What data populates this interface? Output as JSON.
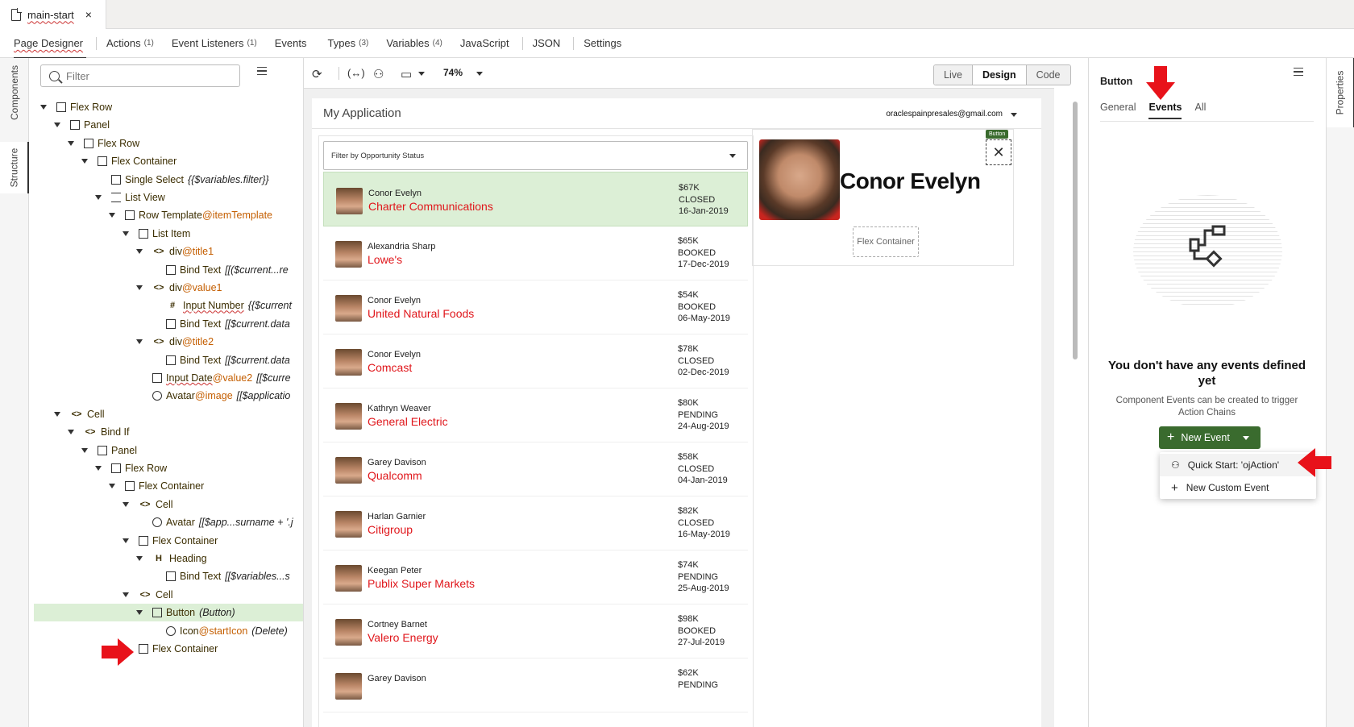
{
  "tab": {
    "title": "main-start",
    "close": "×"
  },
  "designer_tabs": [
    {
      "label": "Page Designer",
      "count": ""
    },
    {
      "label": "Actions",
      "count": "(1)"
    },
    {
      "label": "Event Listeners",
      "count": "(1)"
    },
    {
      "label": "Events",
      "count": ""
    },
    {
      "label": "Types",
      "count": "(3)"
    },
    {
      "label": "Variables",
      "count": "(4)"
    },
    {
      "label": "JavaScript",
      "count": ""
    },
    {
      "label": "JSON",
      "count": ""
    },
    {
      "label": "Settings",
      "count": ""
    }
  ],
  "left_strip": {
    "components": "Components",
    "structure": "Structure"
  },
  "structure": {
    "filter_placeholder": "Filter",
    "nodes": [
      {
        "label": "Flex Row",
        "at": "",
        "expr": ""
      },
      {
        "label": "Panel",
        "at": "",
        "expr": ""
      },
      {
        "label": "Flex Row",
        "at": "",
        "expr": ""
      },
      {
        "label": "Flex Container",
        "at": "",
        "expr": ""
      },
      {
        "label": "Single Select",
        "at": "",
        "expr": "{{$variables.filter}}"
      },
      {
        "label": "List View",
        "at": "",
        "expr": ""
      },
      {
        "label": "Row Template",
        "at": "@itemTemplate",
        "expr": ""
      },
      {
        "label": "List Item",
        "at": "",
        "expr": ""
      },
      {
        "label": "div",
        "at": "@title1",
        "expr": ""
      },
      {
        "label": "Bind Text",
        "at": "",
        "expr": "[[($current...re"
      },
      {
        "label": "div",
        "at": "@value1",
        "expr": ""
      },
      {
        "label": "Input Number",
        "at": "",
        "expr": "{{$current"
      },
      {
        "label": "Bind Text",
        "at": "",
        "expr": "[[$current.data"
      },
      {
        "label": "div",
        "at": "@title2",
        "expr": ""
      },
      {
        "label": "Bind Text",
        "at": "",
        "expr": "[[$current.data"
      },
      {
        "label": "Input Date",
        "at": "@value2",
        "expr": "[[$curre"
      },
      {
        "label": "Avatar",
        "at": "@image",
        "expr": "[[$applicatio"
      },
      {
        "label": "Cell",
        "at": "",
        "expr": ""
      },
      {
        "label": "Bind If",
        "at": "",
        "expr": ""
      },
      {
        "label": "Panel",
        "at": "",
        "expr": ""
      },
      {
        "label": "Flex Row",
        "at": "",
        "expr": ""
      },
      {
        "label": "Flex Container",
        "at": "",
        "expr": ""
      },
      {
        "label": "Cell",
        "at": "",
        "expr": ""
      },
      {
        "label": "Avatar",
        "at": "",
        "expr": "[[$app...surname + '.j"
      },
      {
        "label": "Flex Container",
        "at": "",
        "expr": ""
      },
      {
        "label": "Heading",
        "at": "",
        "expr": ""
      },
      {
        "label": "Bind Text",
        "at": "",
        "expr": "[[$variables...s"
      },
      {
        "label": "Cell",
        "at": "",
        "expr": ""
      },
      {
        "label": "Button",
        "at": "",
        "expr": "(Button)"
      },
      {
        "label": "Icon",
        "at": "@startIcon",
        "expr": "(Delete)"
      },
      {
        "label": "Flex Container",
        "at": "",
        "expr": ""
      }
    ]
  },
  "toolbar": {
    "zoom": "74%",
    "live": "Live",
    "design": "Design",
    "code": "Code"
  },
  "app": {
    "title": "My Application",
    "user": "oraclespainpresales@gmail.com",
    "filter_placeholder": "Filter by Opportunity Status",
    "rows": [
      {
        "name": "Conor Evelyn",
        "company": "Charter Communications",
        "amount": "$67K",
        "status": "CLOSED",
        "date": "16-Jan-2019"
      },
      {
        "name": "Alexandria Sharp",
        "company": "Lowe's",
        "amount": "$65K",
        "status": "BOOKED",
        "date": "17-Dec-2019"
      },
      {
        "name": "Conor Evelyn",
        "company": "United Natural Foods",
        "amount": "$54K",
        "status": "BOOKED",
        "date": "06-May-2019"
      },
      {
        "name": "Conor Evelyn",
        "company": "Comcast",
        "amount": "$78K",
        "status": "CLOSED",
        "date": "02-Dec-2019"
      },
      {
        "name": "Kathryn Weaver",
        "company": "General Electric",
        "amount": "$80K",
        "status": "PENDING",
        "date": "24-Aug-2019"
      },
      {
        "name": "Garey Davison",
        "company": "Qualcomm",
        "amount": "$58K",
        "status": "CLOSED",
        "date": "04-Jan-2019"
      },
      {
        "name": "Harlan Garnier",
        "company": "Citigroup",
        "amount": "$82K",
        "status": "CLOSED",
        "date": "16-May-2019"
      },
      {
        "name": "Keegan Peter",
        "company": "Publix Super Markets",
        "amount": "$74K",
        "status": "PENDING",
        "date": "25-Aug-2019"
      },
      {
        "name": "Cortney Barnet",
        "company": "Valero Energy",
        "amount": "$98K",
        "status": "BOOKED",
        "date": "27-Jul-2019"
      },
      {
        "name": "Garey Davison",
        "company": "",
        "amount": "$62K",
        "status": "PENDING",
        "date": ""
      }
    ],
    "detail": {
      "name": "Conor Evelyn",
      "flex_container": "Flex Container",
      "button_badge": "Button"
    }
  },
  "properties": {
    "title": "Button",
    "tabs": [
      "General",
      "Events",
      "All"
    ],
    "empty_heading": "You don't have any events defined yet",
    "empty_text": "Component Events can be created to trigger Action Chains",
    "new_event": "New Event",
    "menu": [
      "Quick Start: 'ojAction'",
      "New Custom Event"
    ],
    "strip": "Properties"
  },
  "colors": {
    "accent_green": "#3a6b2e",
    "selection": "#dcefd6",
    "company_red": "#e0161b",
    "arrow_red": "#e8121a"
  }
}
